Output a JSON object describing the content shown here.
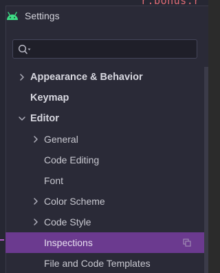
{
  "background_editor": {
    "code_fragment": "r.bonus.r"
  },
  "titlebar": {
    "title": "Settings",
    "icon": "android-icon"
  },
  "search": {
    "value": "",
    "placeholder": ""
  },
  "tree": {
    "items": [
      {
        "label": "Appearance & Behavior",
        "level": 0,
        "expandable": true,
        "expanded": false,
        "bold": true
      },
      {
        "label": "Keymap",
        "level": 0,
        "expandable": false,
        "bold": true
      },
      {
        "label": "Editor",
        "level": 0,
        "expandable": true,
        "expanded": true,
        "bold": true
      },
      {
        "label": "General",
        "level": 1,
        "expandable": true,
        "expanded": false
      },
      {
        "label": "Code Editing",
        "level": 1,
        "expandable": false
      },
      {
        "label": "Font",
        "level": 1,
        "expandable": false
      },
      {
        "label": "Color Scheme",
        "level": 1,
        "expandable": true,
        "expanded": false
      },
      {
        "label": "Code Style",
        "level": 1,
        "expandable": true,
        "expanded": false
      },
      {
        "label": "Inspections",
        "level": 1,
        "expandable": false,
        "selected": true,
        "icon": "copy-icon"
      },
      {
        "label": "File and Code Templates",
        "level": 1,
        "expandable": false
      }
    ]
  },
  "colors": {
    "background": "#2a2a37",
    "selection": "#6b3a8f",
    "accent": "#3ddc84",
    "text": "#c9c9d1"
  }
}
